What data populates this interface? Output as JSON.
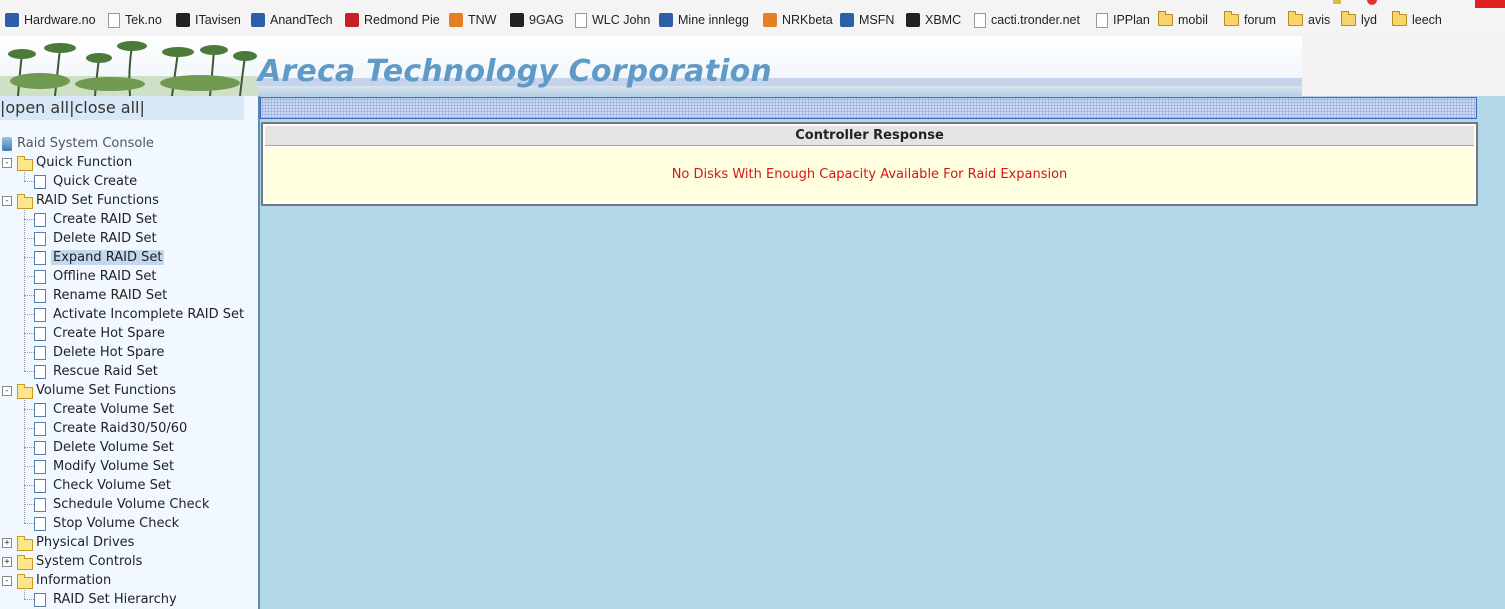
{
  "bookmarks": [
    {
      "label": "Hardware.no",
      "icon": "hardware-no-icon"
    },
    {
      "label": "Tek.no",
      "icon": "power-icon"
    },
    {
      "label": "ITavisen",
      "icon": "itavisen-icon"
    },
    {
      "label": "AnandTech",
      "icon": "anandtech-icon"
    },
    {
      "label": "Redmond Pie",
      "icon": "redmond-pie-icon"
    },
    {
      "label": "TNW",
      "icon": "tnw-icon"
    },
    {
      "label": "9GAG",
      "icon": "9gag-icon"
    },
    {
      "label": "WLC John",
      "icon": "page-icon"
    },
    {
      "label": "Mine innlegg",
      "icon": "mine-innlegg-icon"
    },
    {
      "label": "NRKbeta",
      "icon": "nrkbeta-icon"
    },
    {
      "label": "MSFN",
      "icon": "msfn-icon"
    },
    {
      "label": "XBMC",
      "icon": "xbmc-icon"
    },
    {
      "label": "cacti.tronder.net",
      "icon": "page-icon"
    },
    {
      "label": "IPPlan",
      "icon": "page-icon"
    },
    {
      "label": "mobil",
      "icon": "folder-icon"
    },
    {
      "label": "forum",
      "icon": "folder-icon"
    },
    {
      "label": "avis",
      "icon": "folder-icon"
    },
    {
      "label": "lyd",
      "icon": "folder-icon"
    },
    {
      "label": "leech",
      "icon": "folder-icon"
    }
  ],
  "header": {
    "title": "Areca Technology Corporation"
  },
  "tree": {
    "open_all": "open all",
    "close_all": "close all",
    "root": "Raid System Console",
    "groups": [
      {
        "label": "Quick Function",
        "expanded": true,
        "items": [
          "Quick Create"
        ]
      },
      {
        "label": "RAID Set Functions",
        "expanded": true,
        "items": [
          "Create RAID Set",
          "Delete RAID Set",
          "Expand RAID Set",
          "Offline RAID Set",
          "Rename RAID Set",
          "Activate Incomplete RAID Set",
          "Create Hot Spare",
          "Delete Hot Spare",
          "Rescue Raid Set"
        ]
      },
      {
        "label": "Volume Set Functions",
        "expanded": true,
        "items": [
          "Create Volume Set",
          "Create Raid30/50/60",
          "Delete Volume Set",
          "Modify Volume Set",
          "Check Volume Set",
          "Schedule Volume Check",
          "Stop Volume Check"
        ]
      },
      {
        "label": "Physical Drives",
        "expanded": false,
        "items": []
      },
      {
        "label": "System Controls",
        "expanded": false,
        "items": []
      },
      {
        "label": "Information",
        "expanded": true,
        "items": [
          "RAID Set Hierarchy"
        ]
      }
    ],
    "selected": "Expand RAID Set"
  },
  "response": {
    "header": "Controller Response",
    "message": "No Disks With Enough Capacity Available For Raid Expansion"
  },
  "colors": {
    "title": "#5f9bc6",
    "message": "#d01818",
    "main_bg": "#b1d7e8",
    "tree_bg": "#f1f8ff"
  }
}
